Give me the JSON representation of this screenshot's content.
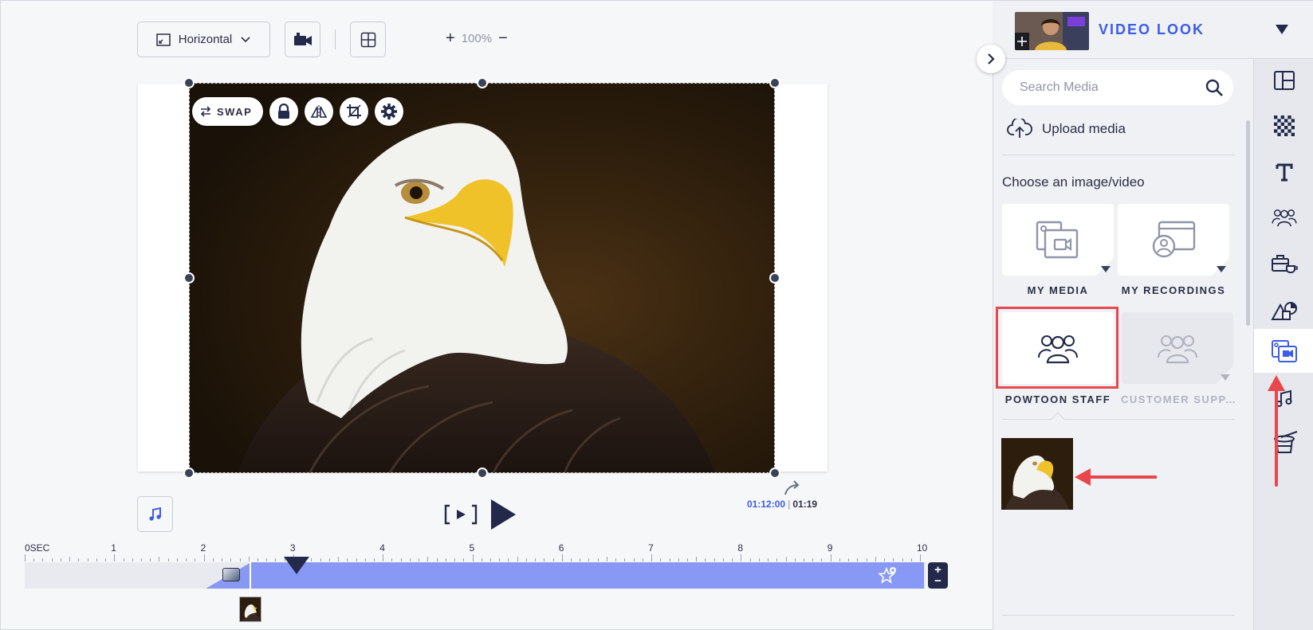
{
  "toolbar": {
    "orientation_label": "Horizontal",
    "zoom_value": "100%",
    "zoom_plus": "+",
    "zoom_minus": "−"
  },
  "image_tools": {
    "swap_label": "SWAP"
  },
  "playback": {
    "current_time": "01:12:00",
    "separator": "|",
    "total_time": "01:19"
  },
  "timeline": {
    "labels": [
      "0SEC",
      "1",
      "2",
      "3",
      "4",
      "5",
      "6",
      "7",
      "8",
      "9",
      "10"
    ],
    "zoom_plus": "+",
    "zoom_minus": "−"
  },
  "panel": {
    "title": "VIDEO LOOK",
    "search_placeholder": "Search Media",
    "upload_label": "Upload media",
    "choose_label": "Choose an image/video",
    "tiles": [
      {
        "label": "MY MEDIA"
      },
      {
        "label": "MY RECORDINGS"
      },
      {
        "label": "POWTOON STAFF"
      },
      {
        "label": "CUSTOMER SUPP..."
      }
    ]
  },
  "colors": {
    "accent": "#3d5ce8",
    "track": "#8798f5",
    "highlight": "#e8484c",
    "dark": "#22294a"
  }
}
